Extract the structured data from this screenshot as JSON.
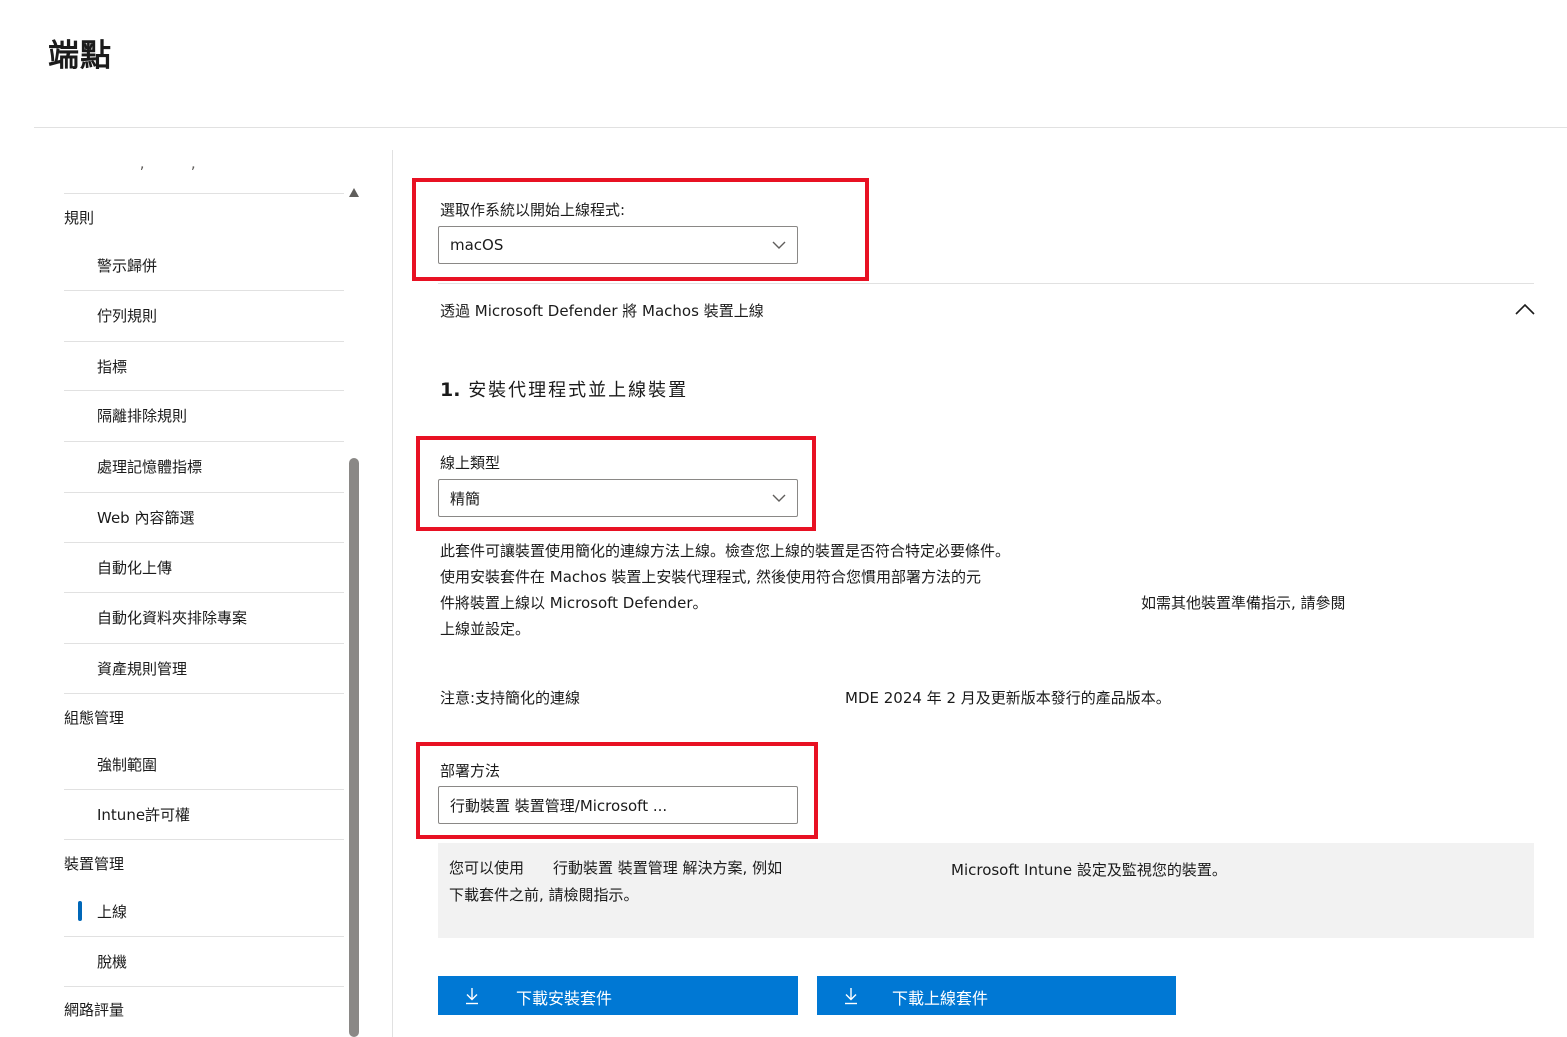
{
  "page": {
    "title": "端點"
  },
  "sidebar": {
    "cut_text": "—  ,  ·  ,",
    "groups": [
      {
        "label": "規則"
      },
      {
        "label": "組態管理"
      },
      {
        "label": "裝置管理"
      },
      {
        "label": "網路評量"
      }
    ],
    "items": [
      {
        "label": "警示歸併"
      },
      {
        "label": "佇列規則"
      },
      {
        "label": "指標"
      },
      {
        "label": "隔離排除規則"
      },
      {
        "label": "處理記憶體指標"
      },
      {
        "label": "Web 內容篩選"
      },
      {
        "label": "自動化上傳"
      },
      {
        "label": "自動化資料夾排除專案"
      },
      {
        "label": "資產規則管理"
      },
      {
        "label": "強制範圍"
      },
      {
        "label": "Intune許可權"
      },
      {
        "label": "上線",
        "active": true
      },
      {
        "label": "脫機"
      }
    ]
  },
  "main": {
    "os_select": {
      "label": "選取作系統以開始上線程式:",
      "value": "macOS"
    },
    "accordion": {
      "header": "透過 Microsoft Defender 將 Machos 裝置上線"
    },
    "step": {
      "number": "1.",
      "title": "安裝代理程式並上線裝置"
    },
    "onboarding_type": {
      "label": "線上類型",
      "value": "精簡"
    },
    "description": {
      "line1": "此套件可讓裝置使用簡化的連線方法上線。檢查您上線的裝置是否符合特定必要條件。",
      "line2": "使用安裝套件在 Machos 裝置上安裝代理程式, 然後使用符合您慣用部署方法的元",
      "line3": "件將裝置上線以 Microsoft  Defender。",
      "line3_right": "如需其他裝置準備指示, 請參閱",
      "line4": "上線並設定。"
    },
    "note": {
      "left": "注意:支持簡化的連線",
      "right": "MDE 2024 年 2 月及更新版本發行的產品版本。"
    },
    "deployment": {
      "label": "部署方法",
      "value": "行動裝置 裝置管理/Microsoft ..."
    },
    "info": {
      "line1_a": "您可以使用",
      "line1_b": "行動裝置  裝置管理 解決方案, 例如",
      "line1_c": "Microsoft  Intune 設定及監視您的裝置。",
      "line2": "下載套件之前, 請檢閱指示。"
    },
    "buttons": {
      "download_install": "下載安裝套件",
      "download_onboarding": "下載上線套件"
    }
  },
  "colors": {
    "accent": "#0078d4",
    "highlight": "#e81123",
    "active_indicator": "#0067b8"
  }
}
